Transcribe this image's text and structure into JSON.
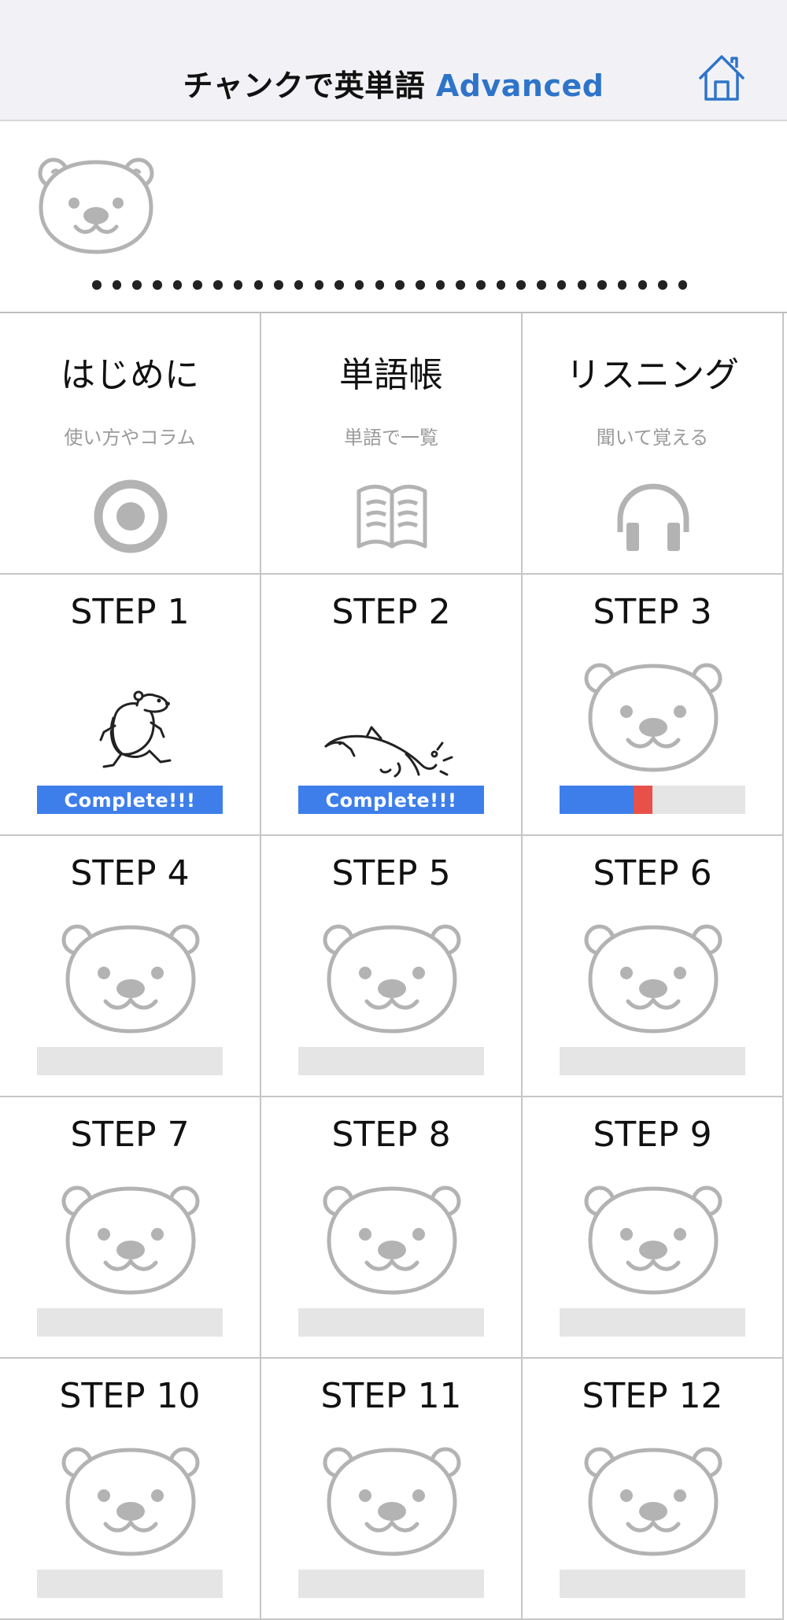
{
  "header": {
    "title_main": "チャンクで英単語",
    "title_accent": "Advanced",
    "home_icon": "home-icon",
    "accent_color": "#2e74c9"
  },
  "mascot": {
    "icon": "bear-face-icon",
    "page_dot_count": 30
  },
  "menu": [
    {
      "title": "はじめに",
      "subtitle": "使い方やコラム",
      "icon": "target-icon"
    },
    {
      "title": "単語帳",
      "subtitle": "単語で一覧",
      "icon": "open-book-icon"
    },
    {
      "title": "リスニング",
      "subtitle": "聞いて覚える",
      "icon": "headphones-icon"
    }
  ],
  "steps": [
    {
      "label": "STEP 1",
      "status": "complete",
      "status_text": "Complete!!!",
      "art": "running-bear"
    },
    {
      "label": "STEP 2",
      "status": "complete",
      "status_text": "Complete!!!",
      "art": "diving-dolphin"
    },
    {
      "label": "STEP 3",
      "status": "in-progress",
      "progress_correct": 0.4,
      "progress_incorrect": 0.1,
      "art": "bear-face"
    },
    {
      "label": "STEP 4",
      "status": "not-started",
      "progress": 0,
      "art": "bear-face"
    },
    {
      "label": "STEP 5",
      "status": "not-started",
      "progress": 0,
      "art": "bear-face"
    },
    {
      "label": "STEP 6",
      "status": "not-started",
      "progress": 0,
      "art": "bear-face"
    },
    {
      "label": "STEP 7",
      "status": "not-started",
      "progress": 0,
      "art": "bear-face"
    },
    {
      "label": "STEP 8",
      "status": "not-started",
      "progress": 0,
      "art": "bear-face"
    },
    {
      "label": "STEP 9",
      "status": "not-started",
      "progress": 0,
      "art": "bear-face"
    },
    {
      "label": "STEP 10",
      "status": "not-started",
      "progress": 0,
      "art": "bear-face"
    },
    {
      "label": "STEP 11",
      "status": "not-started",
      "progress": 0,
      "art": "bear-face"
    },
    {
      "label": "STEP 12",
      "status": "not-started",
      "progress": 0,
      "art": "bear-face"
    }
  ],
  "colors": {
    "progress_blue": "#3d7eea",
    "progress_red": "#e8514a",
    "progress_track": "#e5e5e5",
    "icon_gray": "#b3b3b3"
  }
}
